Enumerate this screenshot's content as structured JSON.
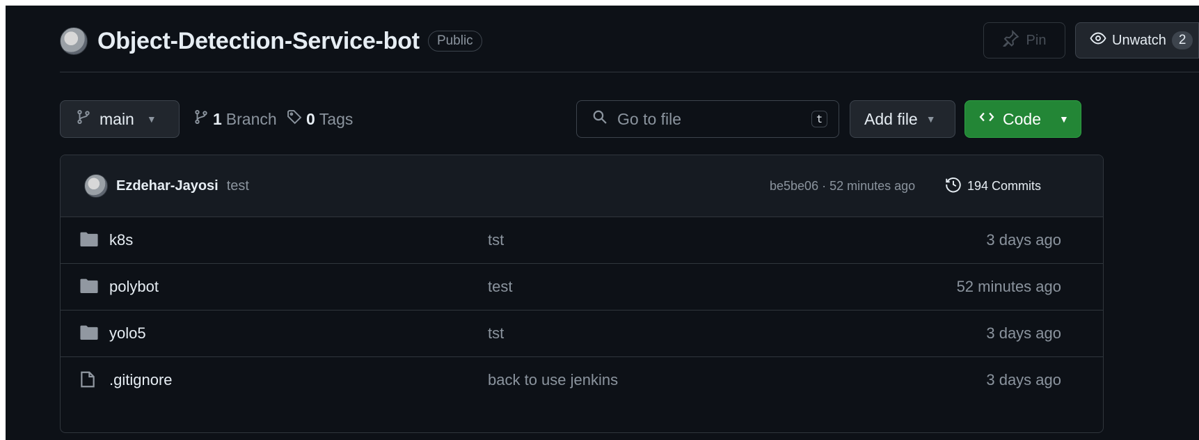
{
  "repo": {
    "name": "Object-Detection-Service-bot",
    "visibility": "Public",
    "pin_label": "Pin",
    "watch_label": "Unwatch",
    "watch_count": "2"
  },
  "toolbar": {
    "branch": "main",
    "branch_count": "1",
    "branch_label": "Branch",
    "tag_count": "0",
    "tag_label": "Tags",
    "search_placeholder": "Go to file",
    "search_shortcut": "t",
    "add_file_label": "Add file",
    "code_label": "Code"
  },
  "latest_commit": {
    "author": "Ezdehar-Jayosi",
    "message": "test",
    "hash_time": "be5be06 · 52 minutes ago",
    "commits_label": "194 Commits"
  },
  "files": [
    {
      "type": "folder",
      "name": "k8s",
      "commit": "tst",
      "age": "3 days ago"
    },
    {
      "type": "folder",
      "name": "polybot",
      "commit": "test",
      "age": "52 minutes ago"
    },
    {
      "type": "folder",
      "name": "yolo5",
      "commit": "tst",
      "age": "3 days ago"
    },
    {
      "type": "file",
      "name": ".gitignore",
      "commit": "back to use jenkins",
      "age": "3 days ago"
    }
  ],
  "colors": {
    "background": "#0d1117",
    "code_button": "#238636",
    "border": "#30363d"
  }
}
